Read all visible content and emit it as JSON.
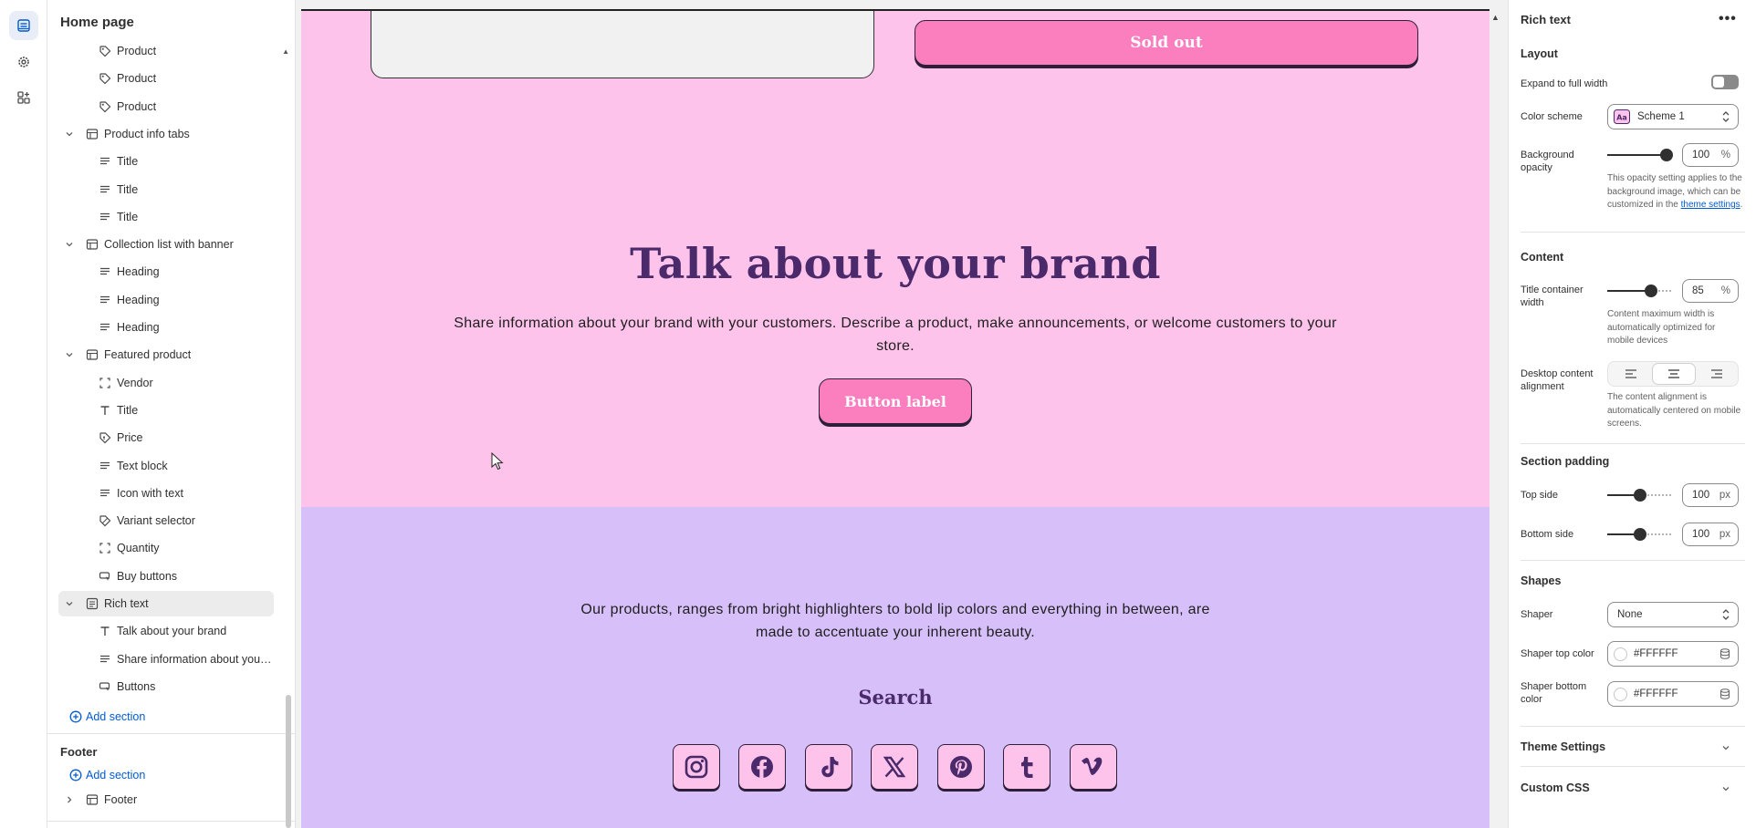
{
  "rail": {
    "items": [
      {
        "icon": "sections-icon",
        "active": true
      },
      {
        "icon": "gear-icon",
        "active": false
      },
      {
        "icon": "apps-icon",
        "active": false
      }
    ]
  },
  "sidebar": {
    "title": "Home page",
    "tree": [
      {
        "kind": "blk",
        "icon": "tag-icon",
        "label": "Product"
      },
      {
        "kind": "blk",
        "icon": "tag-icon",
        "label": "Product"
      },
      {
        "kind": "blk",
        "icon": "tag-icon",
        "label": "Product"
      },
      {
        "kind": "sec",
        "icon": "section-icon",
        "label": "Product info tabs"
      },
      {
        "kind": "blk",
        "icon": "text-lines-icon",
        "label": "Title"
      },
      {
        "kind": "blk",
        "icon": "text-lines-icon",
        "label": "Title"
      },
      {
        "kind": "blk",
        "icon": "text-lines-icon",
        "label": "Title"
      },
      {
        "kind": "sec",
        "icon": "section-icon",
        "label": "Collection list with banner"
      },
      {
        "kind": "blk",
        "icon": "text-lines-icon",
        "label": "Heading"
      },
      {
        "kind": "blk",
        "icon": "text-lines-icon",
        "label": "Heading"
      },
      {
        "kind": "blk",
        "icon": "text-lines-icon",
        "label": "Heading"
      },
      {
        "kind": "sec",
        "icon": "section-icon",
        "label": "Featured product"
      },
      {
        "kind": "blk",
        "icon": "frame-icon",
        "label": "Vendor"
      },
      {
        "kind": "blk",
        "icon": "title-t-icon",
        "label": "Title"
      },
      {
        "kind": "blk",
        "icon": "price-tag-icon",
        "label": "Price"
      },
      {
        "kind": "blk",
        "icon": "text-lines-icon",
        "label": "Text block"
      },
      {
        "kind": "blk",
        "icon": "text-lines-icon",
        "label": "Icon with text"
      },
      {
        "kind": "blk",
        "icon": "variant-icon",
        "label": "Variant selector"
      },
      {
        "kind": "blk",
        "icon": "frame-icon",
        "label": "Quantity"
      },
      {
        "kind": "blk",
        "icon": "button-icon",
        "label": "Buy buttons"
      },
      {
        "kind": "sec",
        "icon": "rich-text-icon",
        "label": "Rich text",
        "selected": true
      },
      {
        "kind": "blk",
        "icon": "title-t-icon",
        "label": "Talk about your brand"
      },
      {
        "kind": "blk",
        "icon": "text-lines-icon",
        "label": "Share information about your br..."
      },
      {
        "kind": "blk",
        "icon": "button-icon",
        "label": "Buttons"
      }
    ],
    "add_section": "Add section",
    "footer_group_title": "Footer",
    "footer_add_section": "Add section",
    "footer_item": "Footer"
  },
  "preview": {
    "sold_out": "Sold out",
    "heading": "Talk about your brand",
    "paragraph": "Share information about your brand with your customers. Describe a product, make announcements, or welcome customers to your store.",
    "button_label": "Button label",
    "lilac_paragraph": "Our products, ranges from bright highlighters to bold lip colors and everything in between, are made to accentuate your inherent beauty.",
    "search_heading": "Search",
    "socials": [
      "instagram-icon",
      "facebook-icon",
      "tiktok-icon",
      "x-icon",
      "pinterest-icon",
      "tumblr-icon",
      "vimeo-icon"
    ],
    "colors": {
      "pink": "#fdc3ea",
      "lilac": "#d7c0fa",
      "button": "#fb7fbe",
      "heading": "#4a2a6b"
    }
  },
  "settings": {
    "title": "Rich text",
    "layout_heading": "Layout",
    "expand_label": "Expand to full width",
    "expand_on": false,
    "color_scheme_label": "Color scheme",
    "color_scheme_value": "Scheme 1",
    "bg_opacity_label": "Background opacity",
    "bg_opacity_value": "100",
    "bg_opacity_unit": "%",
    "bg_opacity_level": 1.0,
    "bg_opacity_help": "This opacity setting applies to the background image, which can be customized in the",
    "bg_opacity_link": "theme settings",
    "content_heading": "Content",
    "title_width_label": "Title container width",
    "title_width_value": "85",
    "title_width_unit": "%",
    "title_width_level": 0.7,
    "title_width_help": "Content maximum width is automatically optimized for mobile devices",
    "alignment_label": "Desktop content alignment",
    "alignment_selected": "center",
    "alignment_help": "The content alignment is automatically centered on mobile screens.",
    "padding_heading": "Section padding",
    "top_label": "Top side",
    "top_value": "100",
    "top_unit": "px",
    "top_level": 0.5,
    "bottom_label": "Bottom side",
    "bottom_value": "100",
    "bottom_unit": "px",
    "bottom_level": 0.5,
    "shapes_heading": "Shapes",
    "shaper_label": "Shaper",
    "shaper_value": "None",
    "shaper_top_label": "Shaper top color",
    "shaper_top_value": "#FFFFFF",
    "shaper_bottom_label": "Shaper bottom color",
    "shaper_bottom_value": "#FFFFFF",
    "theme_settings": "Theme Settings",
    "custom_css": "Custom CSS"
  }
}
